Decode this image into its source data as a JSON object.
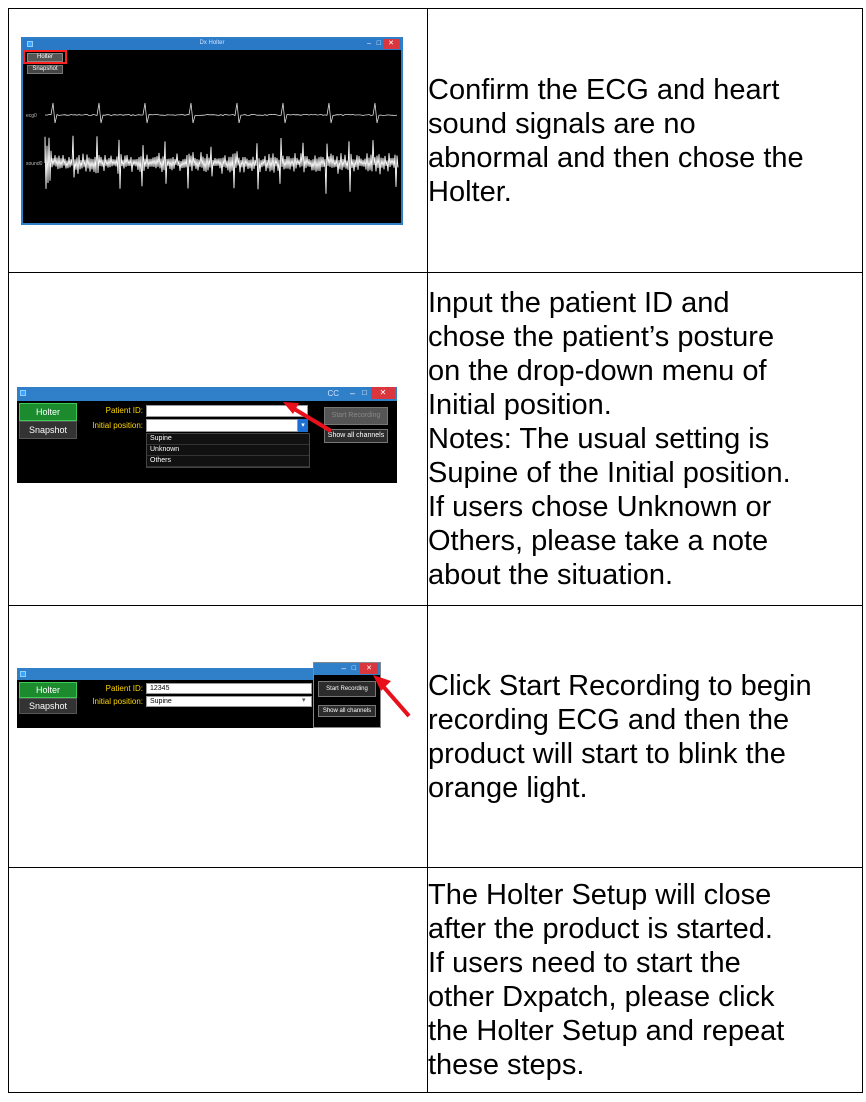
{
  "steps": [
    {
      "screenshot": {
        "window_title": "Dx Holter",
        "tabs": [
          "Holter",
          "Snapshot"
        ],
        "channel_labels": [
          "ecg0",
          "sound0"
        ],
        "highlight_color": "#ff2020"
      },
      "lines": [
        "Confirm the ECG and heart",
        "sound signals are no",
        "abnormal and then chose the",
        "Holter."
      ]
    },
    {
      "screenshot": {
        "window_title": "CC",
        "tabs": [
          "Holter",
          "Snapshot"
        ],
        "patient_id_label": "Patient ID:",
        "initial_position_label": "Initial position:",
        "patient_id_value": "",
        "initial_position_value": "",
        "dropdown_options": [
          "Supine",
          "Unknown",
          "Others"
        ],
        "buttons": [
          "Start Recording",
          "Show all channels"
        ],
        "arrow_color": "#e8101a"
      },
      "lines": [
        "Input the patient ID and",
        "chose the patient’s posture",
        "on the drop-down menu of",
        "Initial position.",
        "Notes: The usual setting is",
        "Supine of the Initial position.",
        "If users chose Unknown or",
        "Others, please take a note",
        "about the situation."
      ]
    },
    {
      "screenshot": {
        "tabs": [
          "Holter",
          "Snapshot"
        ],
        "patient_id_label": "Patient ID:",
        "initial_position_label": "Initial position:",
        "patient_id_value": "12345",
        "initial_position_value": "Supine",
        "buttons": [
          "Start Recording",
          "Show all channels"
        ],
        "arrow_color": "#e8101a"
      },
      "lines": [
        "Click Start Recording to begin",
        "recording ECG and then the",
        "product will start to blink the",
        "orange light."
      ]
    },
    {
      "screenshot": null,
      "lines": [
        "The Holter Setup will close",
        "after the product is started.",
        "If users need to start the",
        "other Dxpatch, please click",
        "the Holter Setup and repeat",
        "these steps."
      ]
    }
  ]
}
